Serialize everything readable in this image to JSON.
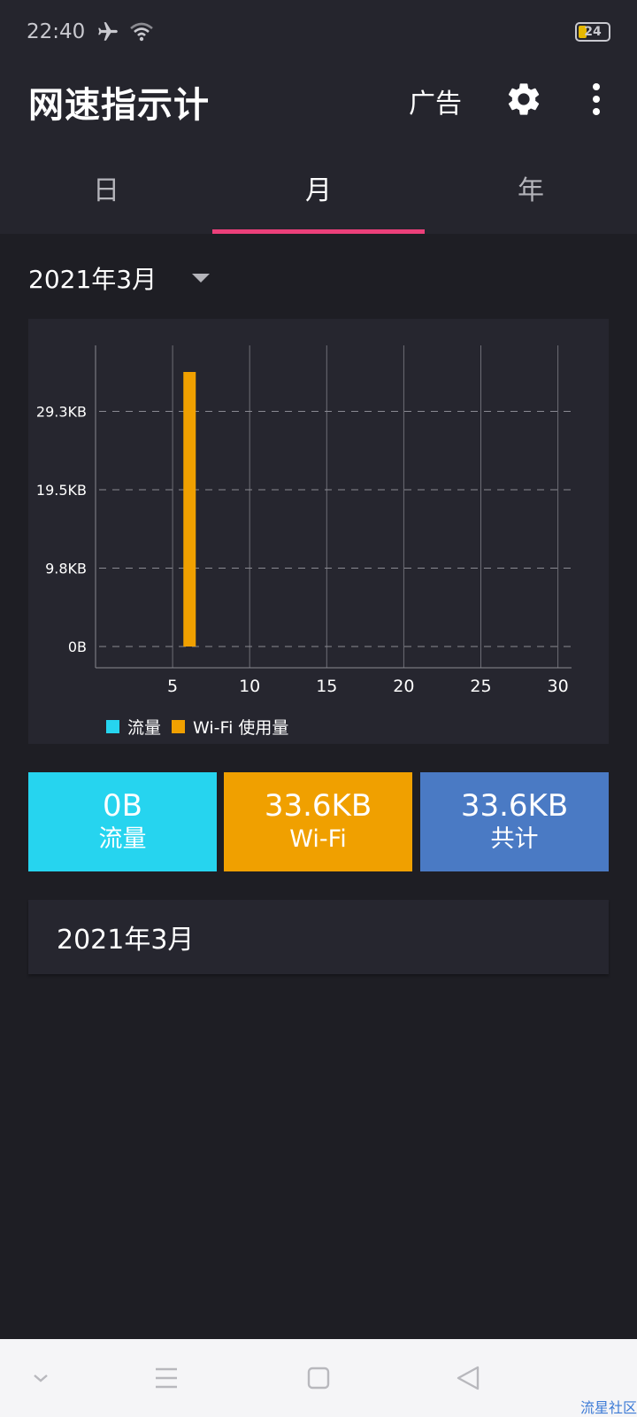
{
  "status_bar": {
    "time": "22:40",
    "battery": "24",
    "battery_level": 0.24,
    "icons": [
      "airplane-icon",
      "wifi-icon"
    ]
  },
  "app_bar": {
    "title": "网速指示计",
    "ad_label": "广告",
    "icons": [
      "gear-icon",
      "more-vert-icon"
    ]
  },
  "tabs": [
    {
      "label": "日",
      "active": false
    },
    {
      "label": "月",
      "active": true
    },
    {
      "label": "年",
      "active": false
    }
  ],
  "month_selector": {
    "value": "2021年3月"
  },
  "colors": {
    "accent": "#ec407a",
    "mobile": "#26d4ef",
    "wifi": "#f0a000",
    "total": "#4a7ac4"
  },
  "chart_data": {
    "type": "bar",
    "xlim": [
      0,
      31
    ],
    "x_ticks": [
      "5",
      "10",
      "15",
      "20",
      "25",
      "30"
    ],
    "y_ticks": [
      "0B",
      "9.8KB",
      "19.5KB",
      "29.3KB"
    ],
    "ylim_kb": [
      0,
      33.6
    ],
    "series": [
      {
        "name": "流量",
        "color": "#26d4ef",
        "points": []
      },
      {
        "name": "Wi-Fi  使用量",
        "color": "#f0a000",
        "points": [
          {
            "x": 6,
            "y_kb": 33.6
          }
        ]
      }
    ],
    "grid": true,
    "legend_position": "bottom"
  },
  "stats": [
    {
      "value": "0B",
      "label": "流量",
      "color": "#26d4ef"
    },
    {
      "value": "33.6KB",
      "label": "Wi-Fi",
      "color": "#f0a000"
    },
    {
      "value": "33.6KB",
      "label": "共计",
      "color": "#4a7ac4"
    }
  ],
  "month_list": [
    {
      "label": "2021年3月"
    }
  ],
  "nav_bar": {
    "buttons": [
      "chevron-down-icon",
      "menu-icon",
      "home-square-icon",
      "back-triangle-icon"
    ],
    "watermark": "流星社区"
  }
}
